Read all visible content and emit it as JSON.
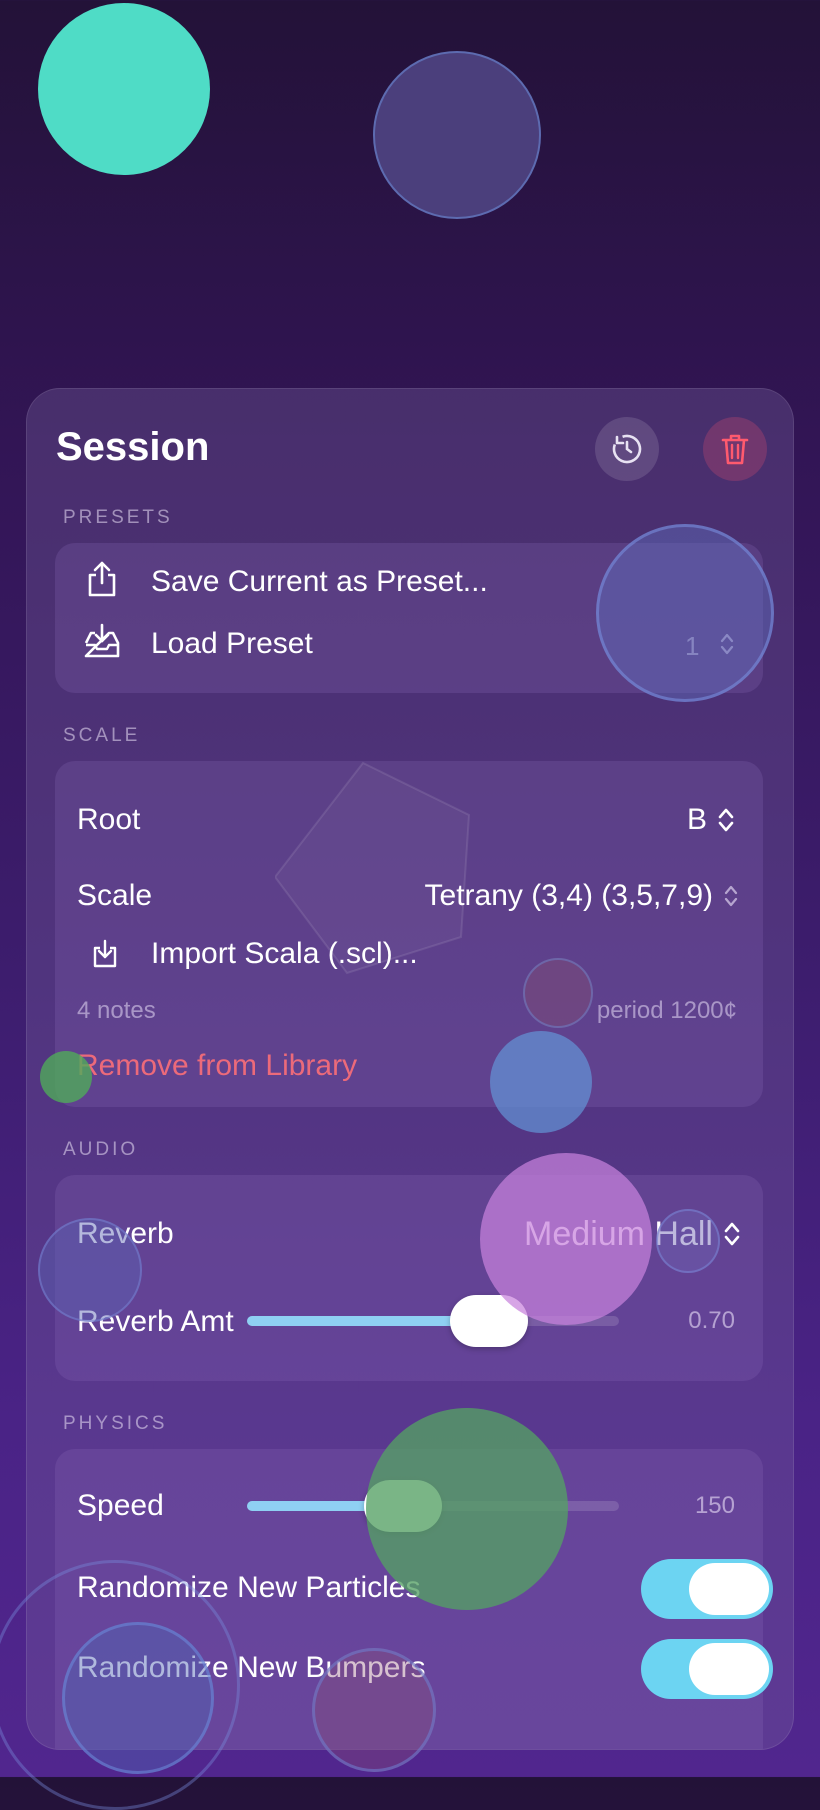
{
  "panel": {
    "title": "Session",
    "reset_icon": "reset-history-icon",
    "trash_icon": "trash-icon"
  },
  "presets": {
    "section_label": "PRESETS",
    "save_label": "Save Current as Preset...",
    "load_label": "Load Preset",
    "load_count": "1"
  },
  "scale": {
    "section_label": "SCALE",
    "root_label": "Root",
    "root_value": "B",
    "scale_label": "Scale",
    "scale_value": "Tetrany (3,4) (3,5,7,9)",
    "import_label": "Import Scala (.scl)...",
    "notes_text": "4 notes",
    "period_text": "period 1200¢",
    "remove_label": "Remove from Library"
  },
  "audio": {
    "section_label": "AUDIO",
    "reverb_label": "Reverb",
    "reverb_value": "Medium Hall",
    "reverb_amt_label": "Reverb Amt",
    "reverb_amt_value": "0.70",
    "reverb_amt_fraction": 0.65
  },
  "physics": {
    "section_label": "PHYSICS",
    "speed_label": "Speed",
    "speed_value": "150",
    "speed_fraction": 0.42,
    "randomize_particles_label": "Randomize New Particles",
    "randomize_particles_on": true,
    "randomize_bumpers_label": "Randomize New Bumpers",
    "randomize_bumpers_on": true
  },
  "colors": {
    "accent": "#8fd0f3",
    "toggle_on": "#6cd4f2",
    "danger": "#ec6a7a"
  }
}
